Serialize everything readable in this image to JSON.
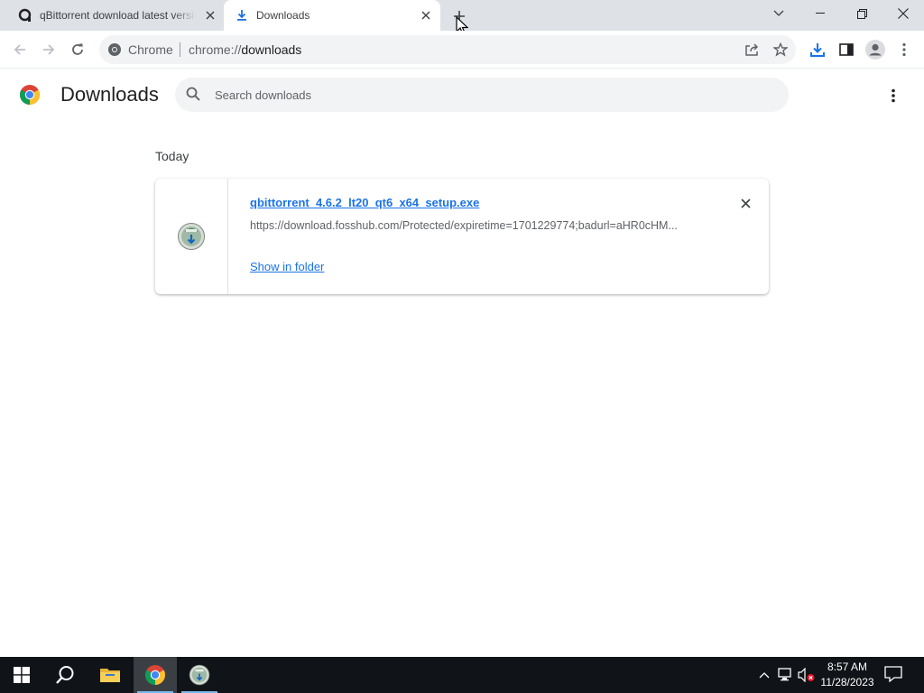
{
  "tabs": [
    {
      "title": "qBittorrent download latest version",
      "active": false
    },
    {
      "title": "Downloads",
      "active": true
    }
  ],
  "omnibox": {
    "site_label": "Chrome",
    "url_scheme": "chrome://",
    "url_path": "downloads"
  },
  "page": {
    "title": "Downloads",
    "search_placeholder": "Search downloads"
  },
  "downloads": {
    "date_header": "Today",
    "items": [
      {
        "file_name": "qbittorrent_4.6.2_lt20_qt6_x64_setup.exe",
        "url": "https://download.fosshub.com/Protected/expiretime=1701229774;badurl=aHR0cHM...",
        "action_label": "Show in folder"
      }
    ]
  },
  "taskbar": {
    "clock_time": "8:57 AM",
    "clock_date": "11/28/2023"
  },
  "colors": {
    "link": "#1a73e8",
    "tabstrip": "#dee1e6",
    "taskbar": "#101418"
  }
}
